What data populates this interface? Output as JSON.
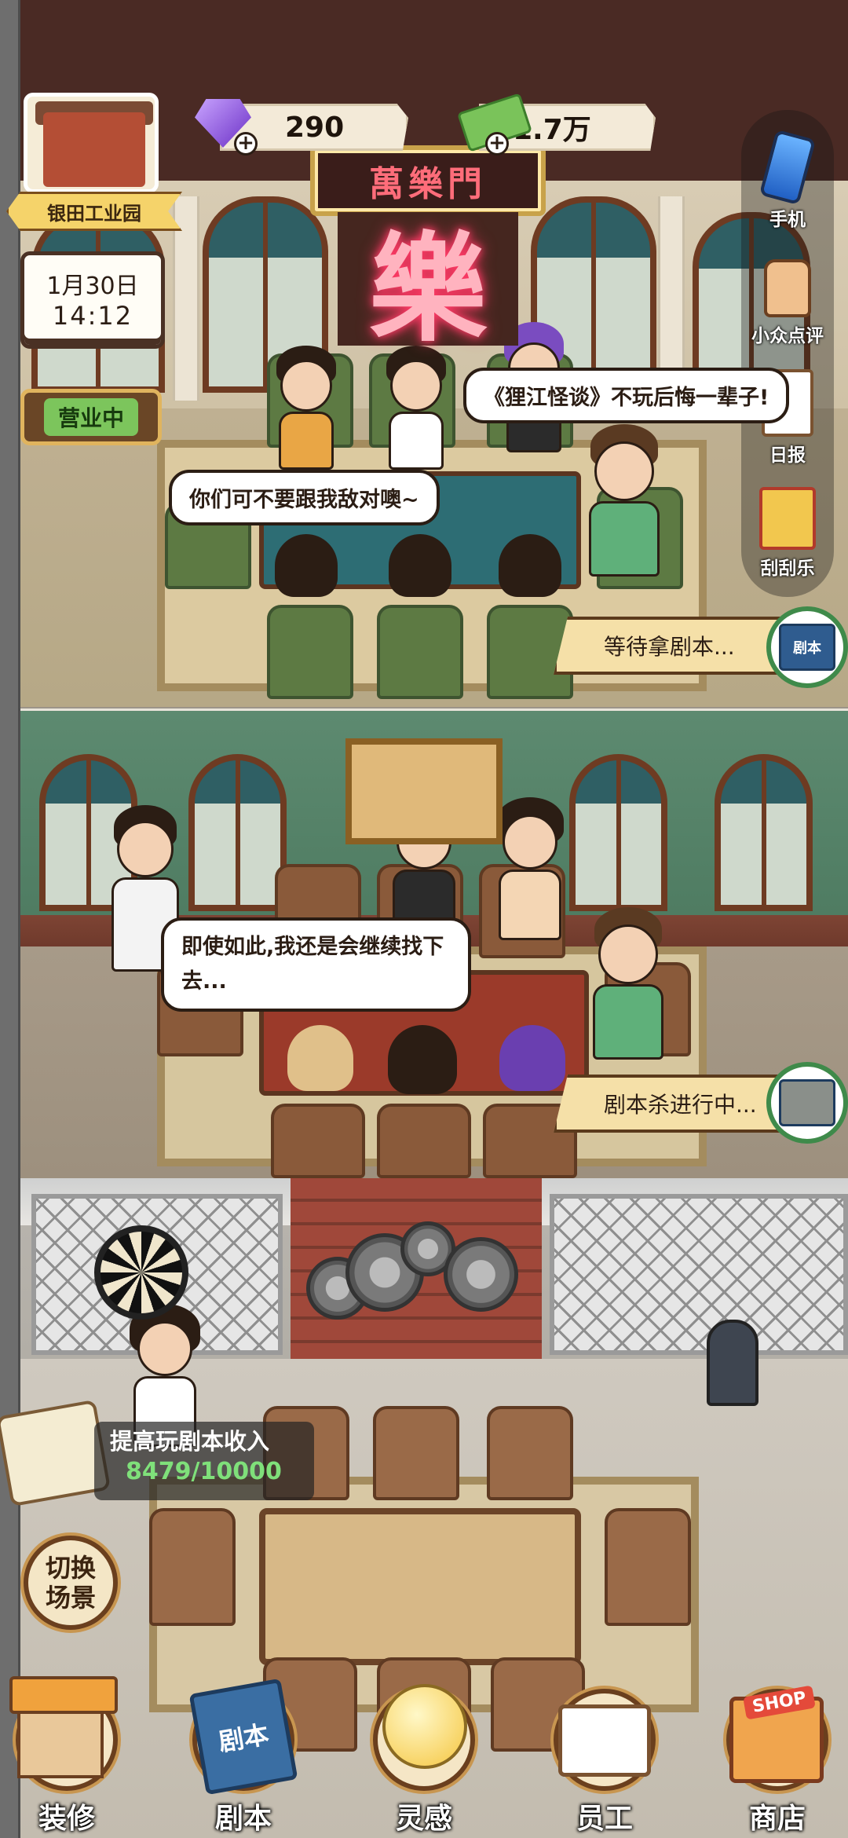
{
  "hud": {
    "location": "银田工业园",
    "gems": "290",
    "cash": "1.7万",
    "plus": "+",
    "date": "1月30日",
    "time": "14:12",
    "open_status": "营业中"
  },
  "scene": {
    "sign_top": "萬樂門",
    "sign_big": "樂"
  },
  "side_menu": [
    {
      "label": "手机",
      "icon": "phone-icon"
    },
    {
      "label": "小众点评",
      "icon": "thumbs-up-icon"
    },
    {
      "label": "日报",
      "icon": "clipboard-icon"
    },
    {
      "label": "刮刮乐",
      "icon": "scratch-ticket-icon"
    }
  ],
  "bubbles": {
    "room1_review": "《狸江怪谈》不玩后悔一辈子!",
    "room1_chat": "你们可不要跟我敌对噢~",
    "room2_chat": "即使如此,我还是会继续找下去..."
  },
  "rooms": {
    "room1_status": "等待拿剧本...",
    "room1_badge": "剧本",
    "room2_status": "剧本杀进行中..."
  },
  "task": {
    "title": "提高玩剧本收入",
    "progress": "8479/10000",
    "current": 8479,
    "target": 10000
  },
  "switch_scene": {
    "line1": "切换",
    "line2": "场景"
  },
  "bottom_nav": [
    {
      "label": "装修",
      "icon": "house-icon"
    },
    {
      "label": "剧本",
      "icon": "script-book-icon",
      "icon_text": "剧本"
    },
    {
      "label": "灵感",
      "icon": "lightbulb-icon"
    },
    {
      "label": "员工",
      "icon": "staff-card-icon"
    },
    {
      "label": "商店",
      "icon": "shop-icon",
      "icon_text": "SHOP"
    }
  ]
}
